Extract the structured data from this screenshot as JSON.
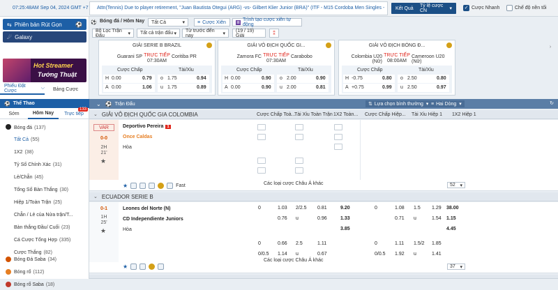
{
  "topbar": {
    "clock": "07:25:48AM Sep 04, 2024 GMT +7",
    "marquee": "Attn(Tennis) Due to player retirement, \"Juan Bautista Otegui (ARG) -vs- Gilbert Klier Junior (BRA)\" (ITF - M15 Cordoba Men Singles -",
    "result_btn": "Kết Quả",
    "odds_type": "Tỷ lệ cược CN",
    "quick_bet": "Cược Nhanh",
    "night_mode": "Chế độ nền tối"
  },
  "left": {
    "banner1": "Phiên bản Rút Gọn",
    "banner2": "Galaxy",
    "promo_line1": "Hot Streamer",
    "promo_line2": "Tướng Thuật",
    "tab_bets": "Phiếu Đặt Cược",
    "tab_board": "Bảng Cược",
    "sport_title": "Thể Thao",
    "tabs": [
      "Sớm",
      "Hôm Nay",
      "Trực tiếp"
    ],
    "live_count": "133",
    "football": "Bóng đá",
    "football_count": "(137)",
    "markets": [
      {
        "label": "Tất Cả",
        "count": "(55)"
      },
      {
        "label": "1X2",
        "count": "(38)"
      },
      {
        "label": "Tỷ Số Chính Xác",
        "count": "(31)"
      },
      {
        "label": "Lẻ/Chẵn",
        "count": "(45)"
      },
      {
        "label": "Tổng Số Bàn Thắng",
        "count": "(30)"
      },
      {
        "label": "Hiệp 1/Toàn Trận",
        "count": "(25)"
      },
      {
        "label": "Chẵn / Lẻ của Nửa trận/T...",
        "count": ""
      },
      {
        "label": "Bàn thắng Đầu/ Cuối",
        "count": "(23)"
      },
      {
        "label": "Cá Cược Tổng Hợp",
        "count": "(335)"
      },
      {
        "label": "Cược Thắng",
        "count": "(82)"
      }
    ],
    "sports": [
      {
        "label": "Bóng Đá Saba",
        "count": "(34)"
      },
      {
        "label": "Bóng rổ",
        "count": "(112)"
      },
      {
        "label": "Bóng rổ Saba",
        "count": "(18)"
      }
    ]
  },
  "filter": {
    "sport": "Bóng đá / Hôm Nay",
    "all": "Tất Cả",
    "parlay": "Cược Xiên",
    "auto_parlay": "Trình tạo cược xiên tự động"
  },
  "filterbar": {
    "league_filter": "Bộ Lọc Trận Đấu",
    "all_matches": "Tất cả trận đấu",
    "before_now": "Từ trước đến nay",
    "league_count": "(19 / 19) Giải"
  },
  "cards": [
    {
      "league": "GIẢI SERIE B BRAZIL",
      "home": "Guarani SP",
      "away": "Coritiba PR",
      "live": "TRỰC TIẾP",
      "time": "07:30AM",
      "hdp_label": "Cược Chấp",
      "ou_label": "Tài/Xỉu",
      "r1": [
        "H",
        "0.00",
        "0.79",
        "o",
        "1.75",
        "0.94"
      ],
      "r2": [
        "A",
        "0.00",
        "1.06",
        "u",
        "1.75",
        "0.89"
      ]
    },
    {
      "league": "GIẢI VÔ ĐỊCH QUỐC GI...",
      "home": "Zamora FC",
      "away": "Carabobo",
      "live": "TRỰC TIẾP",
      "time": "07:30AM",
      "hdp_label": "Cược Chấp",
      "ou_label": "Tài/Xỉu",
      "r1": [
        "H",
        "0.00",
        "0.90",
        "o",
        "2.00",
        "0.90"
      ],
      "r2": [
        "A",
        "0.00",
        "0.90",
        "u",
        "2.00",
        "0.81"
      ]
    },
    {
      "league": "GIẢI VÔ ĐỊCH BÓNG Đ...",
      "home": "Colombia U20 (Nữ)",
      "away": "Cameroon U20 (Nữ)",
      "live": "TRỰC TIẾP",
      "time": "08:00AM",
      "hdp_label": "Cược Chấp",
      "ou_label": "Tài/Xỉu",
      "r1": [
        "H",
        "-0.75",
        "0.80",
        "o",
        "2.50",
        "0.80"
      ],
      "r2": [
        "A",
        "+0.75",
        "0.99",
        "u",
        "2.50",
        "0.97"
      ]
    }
  ],
  "table": {
    "title": "Trận Đấu",
    "sort": "Lựa chọn bình thường",
    "lines": "Hai Dòng",
    "col_hdp": "Cược Chấp Toà...",
    "col_ou": "Tài Xỉu Toàn Trận",
    "col_1x2": "1X2 Toàn...",
    "col_hdp1": "Cược Chấp Hiệp...",
    "col_ou1": "Tài Xỉu Hiệp 1",
    "col_1x21": "1X2 Hiệp 1"
  },
  "leagues": [
    {
      "name": "GIẢI VÔ ĐỊCH QUỐC GIA COLOMBIA",
      "status": "VAR",
      "score": "0-0",
      "period": "2H",
      "minute": "21'",
      "home": "Deportivo Pereira",
      "red_card": "1",
      "away": "Once Caldas",
      "draw": "Hòa",
      "fast": "Fast",
      "more": "Các loại cược Châu Á khác",
      "more_count": "52"
    },
    {
      "name": "ECUADOR SERIE B",
      "score": "0-1",
      "period": "1H",
      "minute": "25'",
      "home": "Leones del Norte (N)",
      "away": "CD Independiente Juniors",
      "draw": "Hòa",
      "more": "Các loại cược Châu Á khác",
      "more_count": "37",
      "row1": [
        "0",
        "1.03",
        "2/2.5",
        "0.81",
        "9.20",
        "0",
        "1.08",
        "1.5",
        "1.29",
        "38.00"
      ],
      "row2": [
        "",
        "0.76",
        "u",
        "0.96",
        "1.33",
        "",
        "0.71",
        "u",
        "1.54",
        "1.15"
      ],
      "row3": [
        "",
        "",
        "",
        "",
        "3.85",
        "",
        "",
        "",
        "",
        "4.45"
      ],
      "row4": [
        "0",
        "0.66",
        "2.5",
        "1.11",
        "",
        "0",
        "1.11",
        "1.5/2",
        "1.85",
        ""
      ],
      "row5": [
        "0/0.5",
        "1.14",
        "u",
        "0.67",
        "",
        "0/0.5",
        "1.92",
        "u",
        "1.41",
        ""
      ]
    }
  ],
  "colors": {
    "accent": "#1d5fa6",
    "header": "#5b7ea6",
    "live": "#e0251b",
    "gold": "#d4a017"
  }
}
